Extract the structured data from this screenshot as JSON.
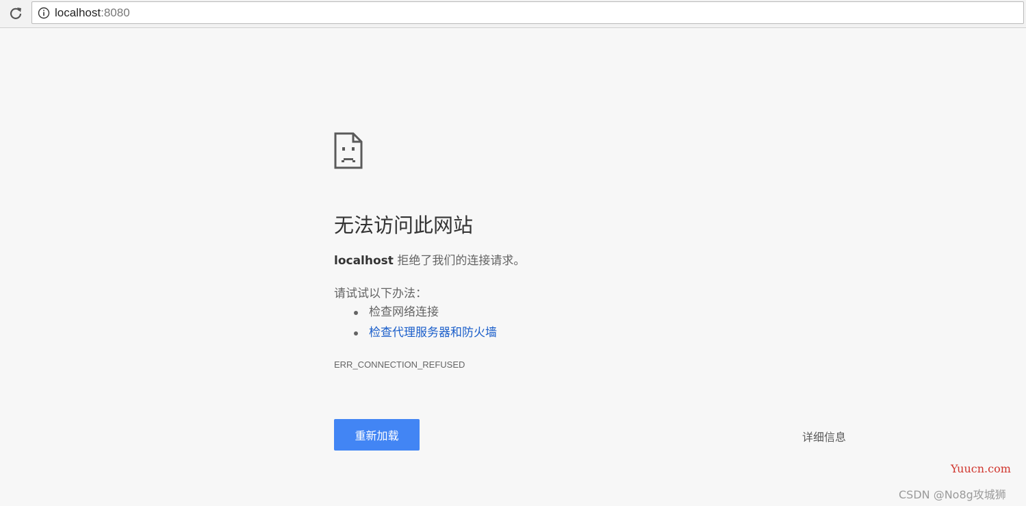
{
  "browser": {
    "url_host": "localhost",
    "url_port": ":8080"
  },
  "error_page": {
    "title": "无法访问此网站",
    "summary_host": "localhost",
    "summary_text": " 拒绝了我们的连接请求。",
    "suggestions_label": "请试试以下办法：",
    "suggestions": [
      "检查网络连接",
      "检查代理服务器和防火墙"
    ],
    "error_code": "ERR_CONNECTION_REFUSED",
    "reload_button": "重新加载",
    "details_button": "详细信息"
  },
  "watermarks": {
    "site": "Yuucn.com",
    "author": "CSDN @No8g攻城狮"
  },
  "colors": {
    "accent": "#4285f4",
    "link": "#1a5eca",
    "watermark_red": "#d0342c"
  },
  "icons": [
    "reload-icon",
    "info-icon",
    "sad-page-icon"
  ]
}
